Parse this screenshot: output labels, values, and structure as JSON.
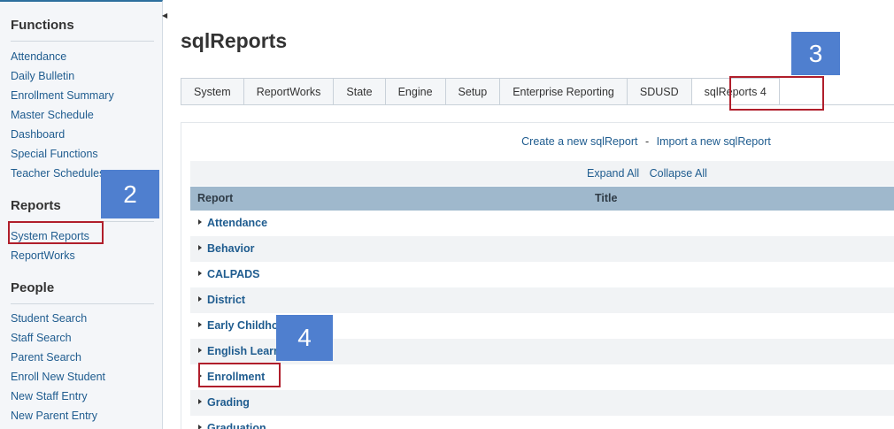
{
  "sidebar": {
    "functions_heading": "Functions",
    "functions": [
      "Attendance",
      "Daily Bulletin",
      "Enrollment Summary",
      "Master Schedule",
      "Dashboard",
      "Special Functions",
      "Teacher Schedules"
    ],
    "reports_heading": "Reports",
    "reports": [
      "System Reports",
      "ReportWorks"
    ],
    "people_heading": "People",
    "people": [
      "Student Search",
      "Staff Search",
      "Parent Search",
      "Enroll New Student",
      "New Staff Entry",
      "New Parent Entry"
    ]
  },
  "main": {
    "title": "sqlReports",
    "tabs": [
      "System",
      "ReportWorks",
      "State",
      "Engine",
      "Setup",
      "Enterprise Reporting",
      "SDUSD",
      "sqlReports 4"
    ],
    "active_tab": "sqlReports 4",
    "create_link": "Create a new sqlReport",
    "separator": "-",
    "import_link": "Import a new sqlReport",
    "expand_all": "Expand All",
    "collapse_all": "Collapse All",
    "table_header": {
      "report": "Report",
      "title": "Title"
    },
    "categories": [
      "Attendance",
      "Behavior",
      "CALPADS",
      "District",
      "Early Childhood",
      "English Learners",
      "Enrollment",
      "Grading",
      "Graduation"
    ]
  },
  "annotations": {
    "badge_2": "2",
    "badge_3": "3",
    "badge_4": "4"
  },
  "colors": {
    "link": "#1f5c8f",
    "header_bg": "#9fb8cc",
    "highlight": "#b01e2b",
    "badge_bg": "#4f7fcf"
  }
}
